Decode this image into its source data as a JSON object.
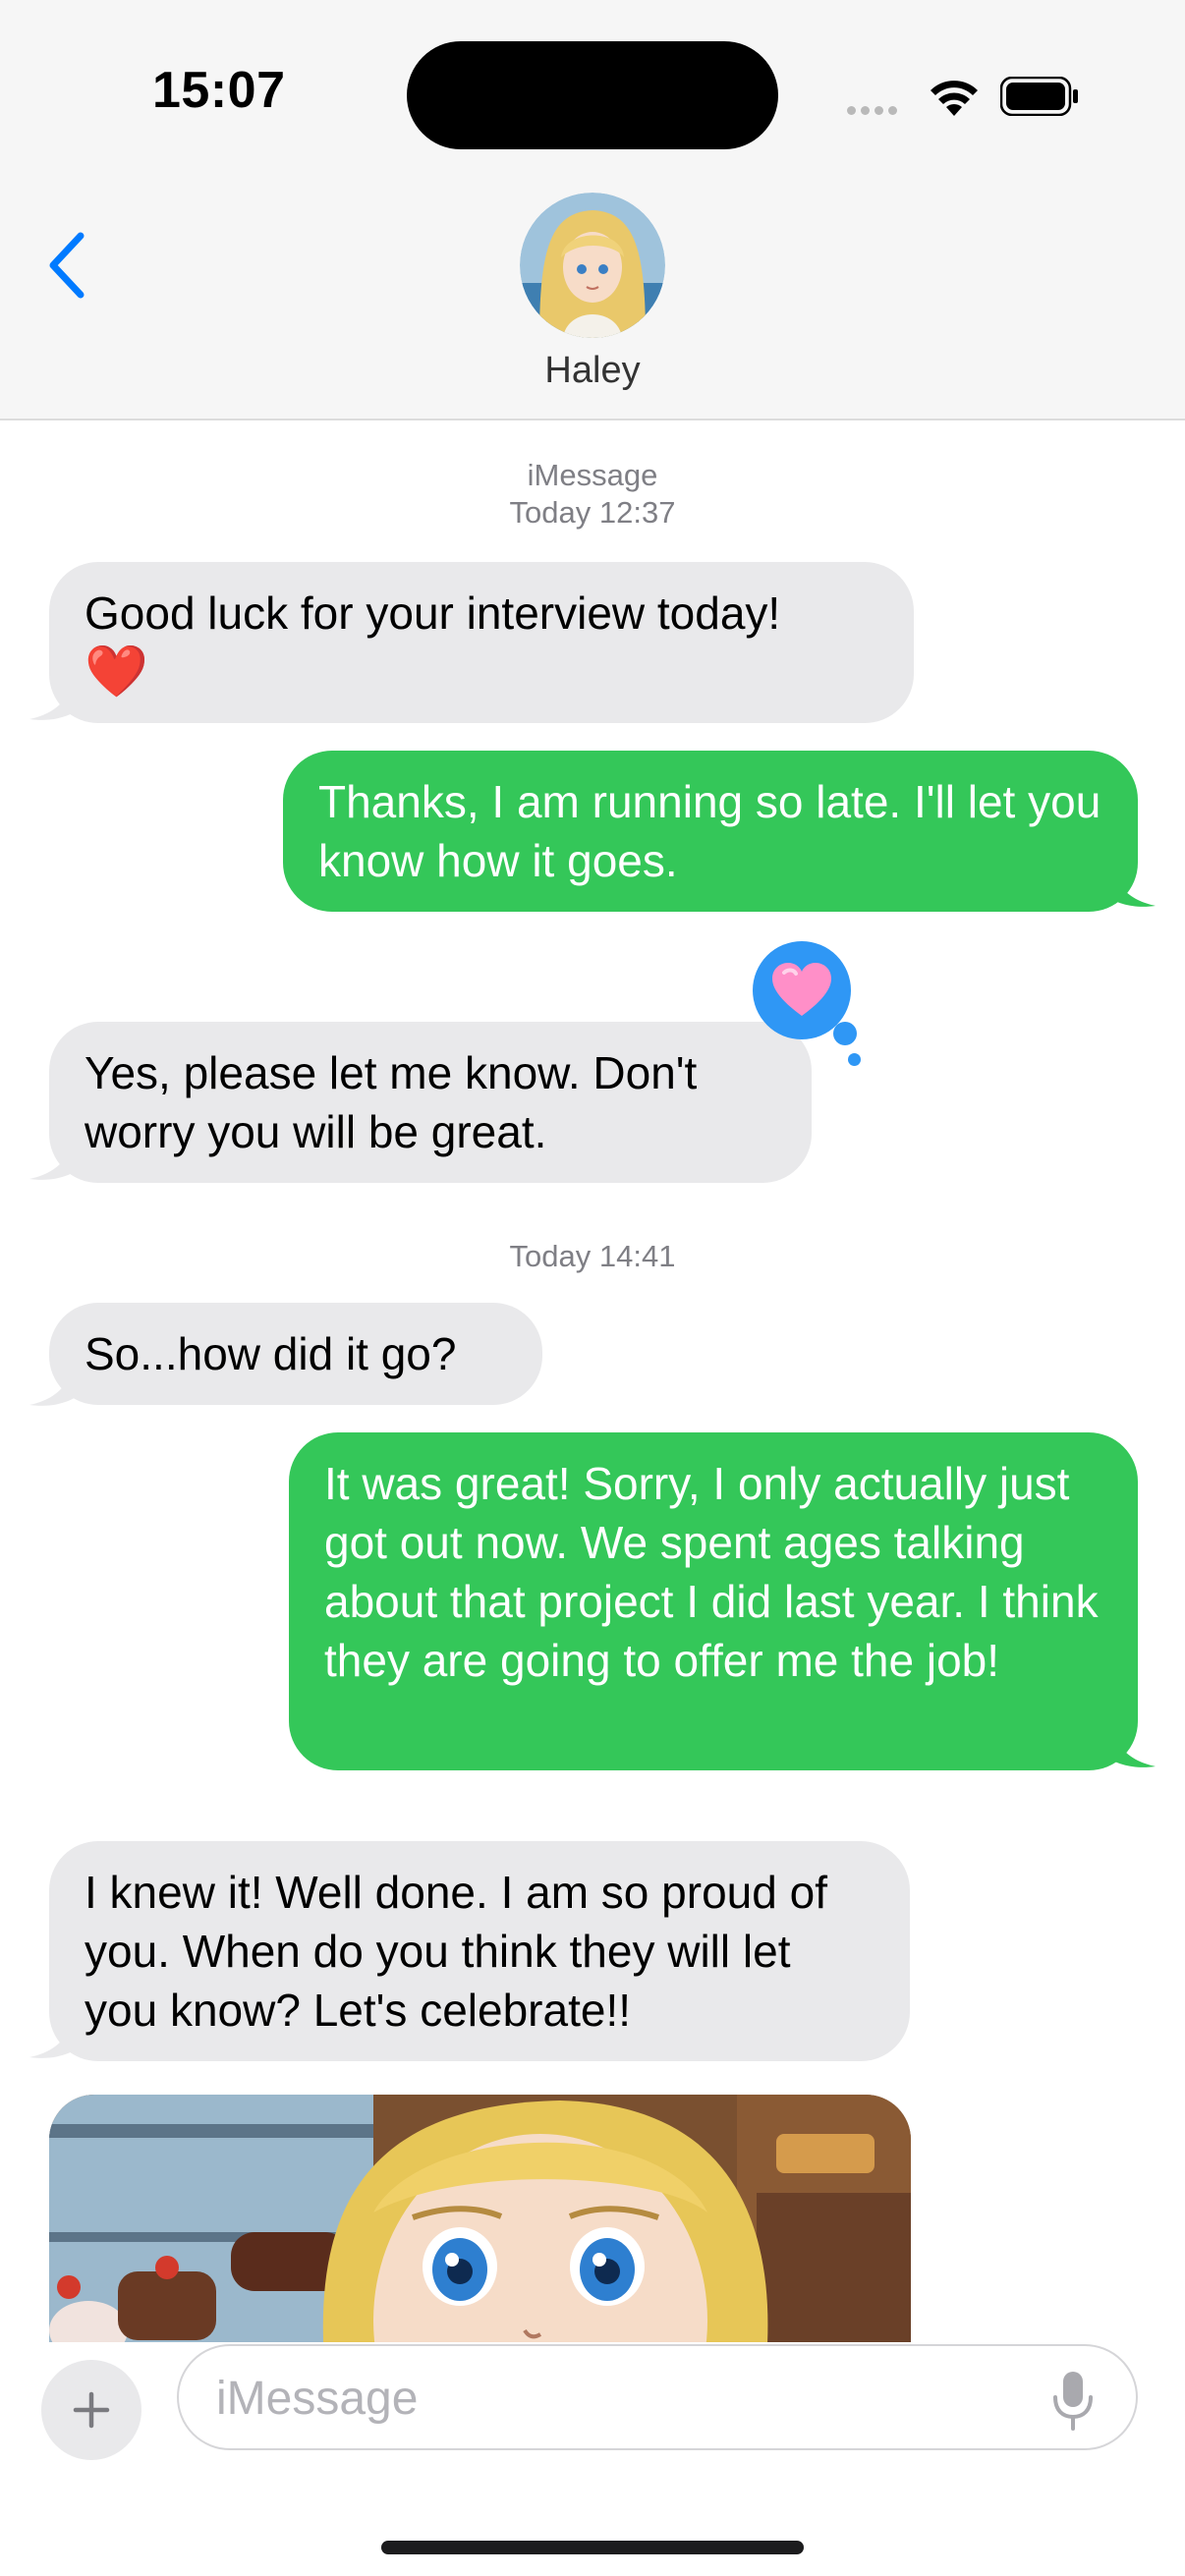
{
  "status_bar": {
    "time": "15:07"
  },
  "header": {
    "contact_name": "Haley"
  },
  "conversation": {
    "service_label": "iMessage",
    "timestamp_1": "Today 12:37",
    "msg1": "Good luck for your interview today!",
    "msg1_emoji": "❤️",
    "msg2": "Thanks, I am running so late. I'll let you know how it goes.",
    "msg3": "Yes, please let me know. Don't worry you will be great.",
    "tapback_emoji": "heart-icon",
    "timestamp_2": "Today 14:41",
    "msg4": "So...how did it go?",
    "msg5": "It was great! Sorry, I only actually just got out now. We spent ages talking about that project I did last year. I think they are going to offer me the job!",
    "msg6": "I knew it! Well done. I am so proud of you. When do you think they will let you know? Let's celebrate!!"
  },
  "composer": {
    "placeholder": "iMessage"
  },
  "colors": {
    "incoming": "#e9e9eb",
    "outgoing": "#34c759",
    "accent": "#007aff",
    "tapback": "#2f97f5"
  }
}
